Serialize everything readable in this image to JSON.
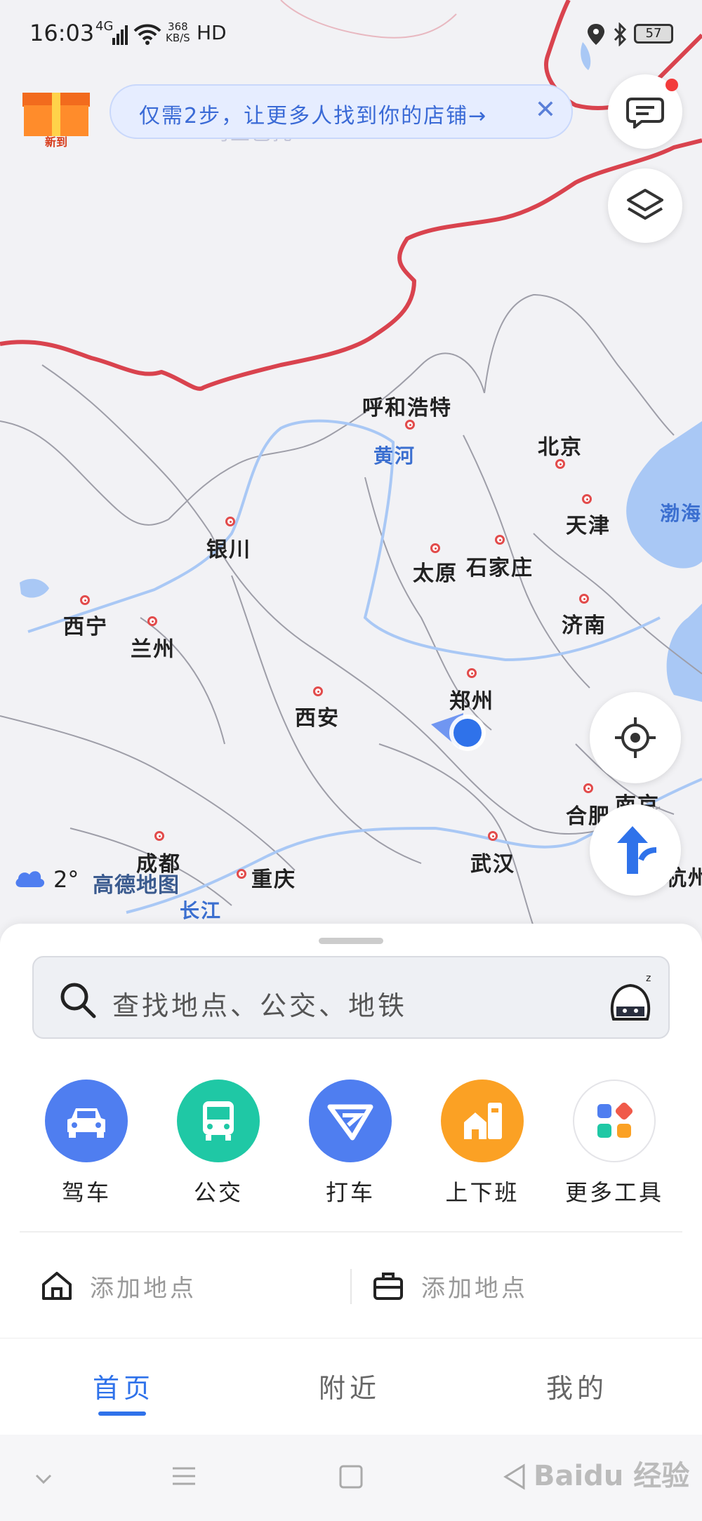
{
  "status_bar": {
    "time": "16:03",
    "network": "4G",
    "speed_value": "368",
    "speed_unit": "KB/S",
    "hd": "HD",
    "battery": "57"
  },
  "promo": {
    "banner_text": "仅需2步，让更多人找到你的店铺→",
    "close_icon": "close-icon",
    "box_label": "新到"
  },
  "map": {
    "cities": [
      "呼和浩特",
      "北京",
      "天津",
      "银川",
      "太原",
      "石家庄",
      "西宁",
      "兰州",
      "济南",
      "西安",
      "郑州",
      "合肥",
      "南京",
      "成都",
      "重庆",
      "武汉",
      "杭州"
    ],
    "rivers": [
      "黄河",
      "长江"
    ],
    "sea": "渤海",
    "weather_temp": "2°",
    "brand": "高德地图",
    "faint_label": "乌兰巴托"
  },
  "search": {
    "placeholder": "查找地点、公交、地铁"
  },
  "tools": [
    {
      "label": "驾车",
      "color": "#4f7ef0"
    },
    {
      "label": "公交",
      "color": "#1fc8a5"
    },
    {
      "label": "打车",
      "color": "#4f7ef0"
    },
    {
      "label": "上下班",
      "color": "#fba124"
    },
    {
      "label": "更多工具",
      "color": "#ffffff"
    }
  ],
  "places": {
    "home": "添加地点",
    "work": "添加地点"
  },
  "tabs": [
    "首页",
    "附近",
    "我的"
  ],
  "watermark": "Baidu 经验",
  "colors": {
    "accent": "#2f72ea",
    "border_red": "#d9434e",
    "water": "#a9c8f5"
  }
}
